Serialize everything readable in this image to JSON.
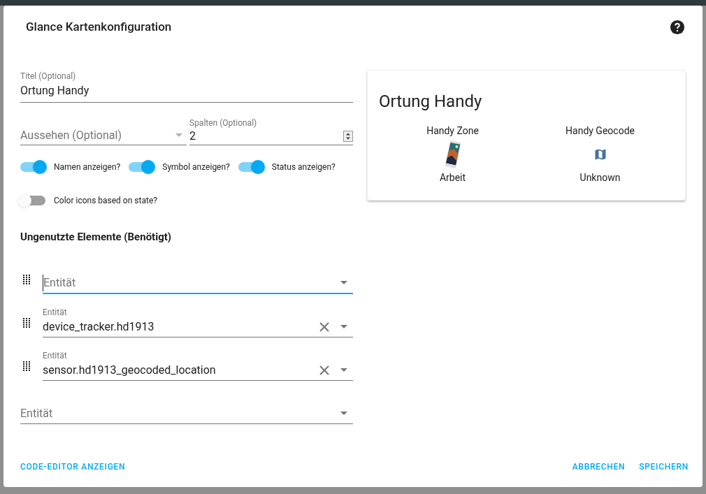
{
  "dialog": {
    "title": "Glance Kartenkonfiguration"
  },
  "title_field": {
    "label": "Titel (Optional)",
    "value": "Ortung Handy"
  },
  "theme_field": {
    "placeholder": "Aussehen (Optional)"
  },
  "columns_field": {
    "label": "Spalten (Optional)",
    "value": "2"
  },
  "toggles": [
    {
      "label": "Namen anzeigen?",
      "on": true
    },
    {
      "label": "Symbol anzeigen?",
      "on": true
    },
    {
      "label": "Status anzeigen?",
      "on": true
    },
    {
      "label": "Color icons based on state?",
      "on": false
    }
  ],
  "section_title": "Ungenutzte Elemente (Benötigt)",
  "entities": [
    {
      "kind": "row",
      "placeholder": "Entität",
      "focused": true
    },
    {
      "kind": "row",
      "label": "Entität",
      "value": "device_tracker.hd1913",
      "focused": false
    },
    {
      "kind": "row",
      "label": "Entität",
      "value": "sensor.hd1913_geocoded_location",
      "focused": false
    },
    {
      "kind": "new",
      "placeholder": "Entität",
      "focused": false
    }
  ],
  "preview": {
    "title": "Ortung Handy",
    "entities": [
      {
        "name": "Handy Zone",
        "kind": "picture",
        "state": "Arbeit"
      },
      {
        "name": "Handy Geocode",
        "kind": "map",
        "state": "Unknown"
      }
    ]
  },
  "buttons": {
    "left": "CODE-EDITOR ANZEIGEN",
    "cancel": "ABBRECHEN",
    "save": "SPEICHERN"
  }
}
